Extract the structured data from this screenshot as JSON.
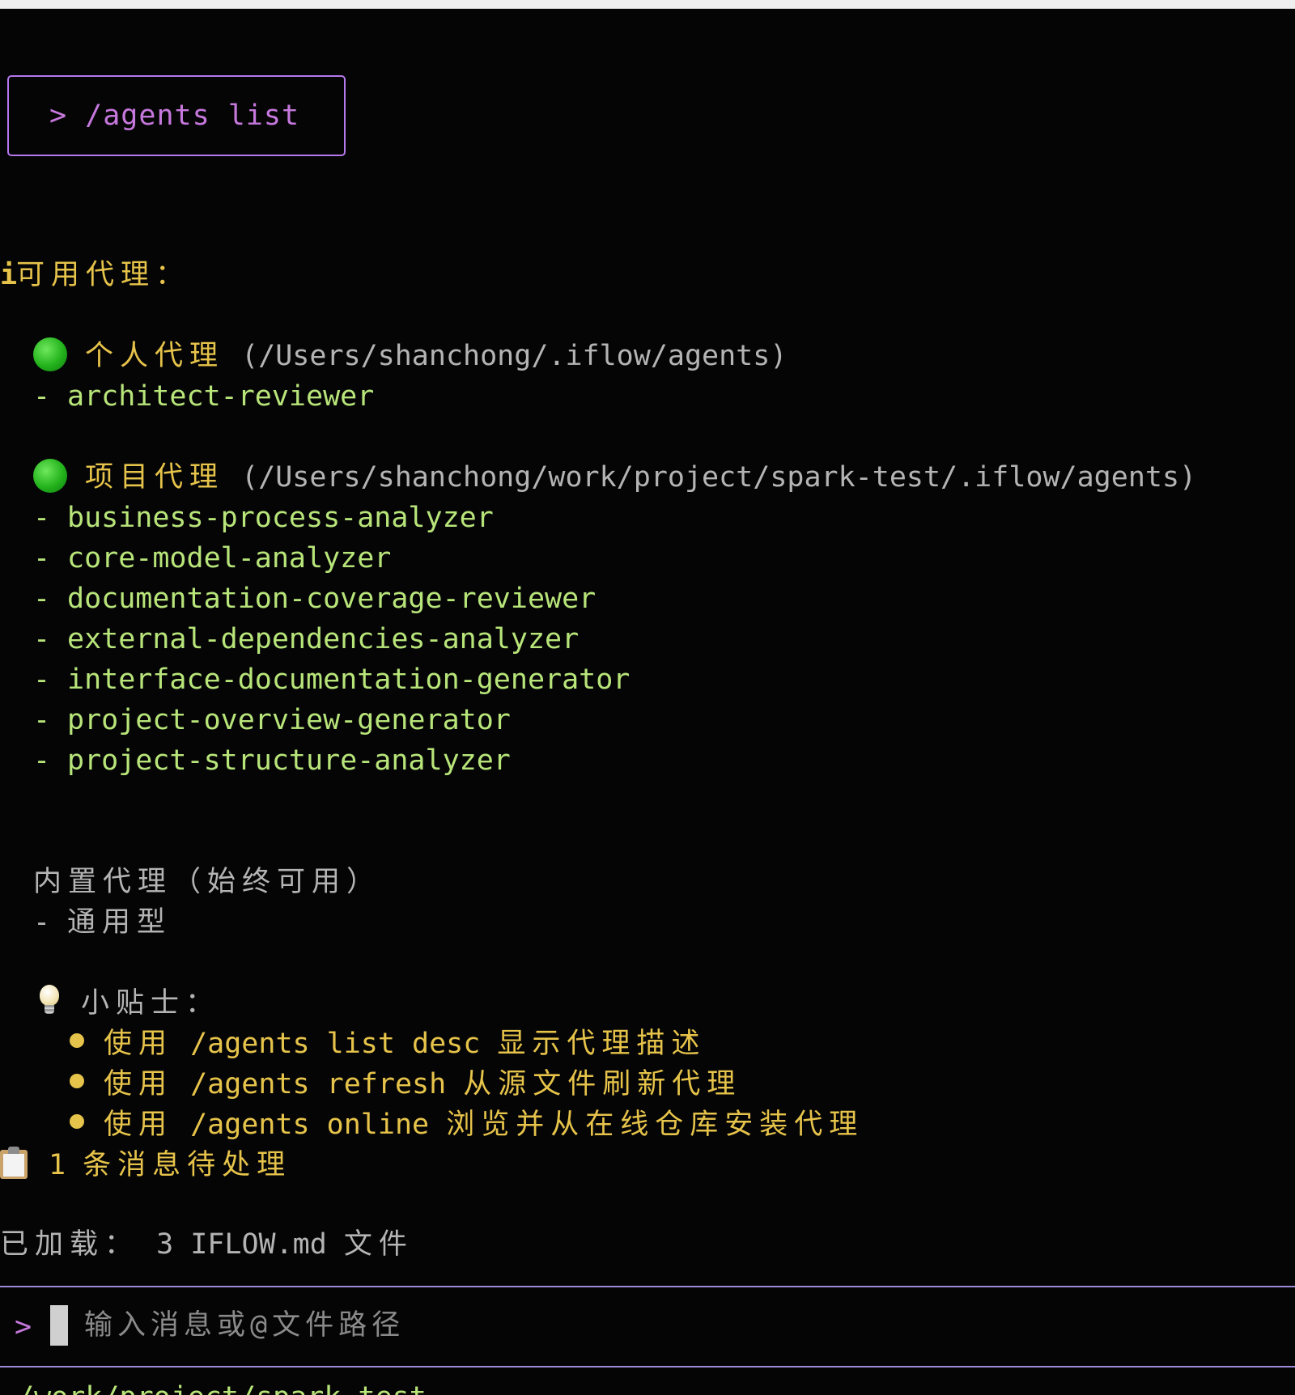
{
  "command": {
    "prompt": ">",
    "text": "/agents list"
  },
  "output": {
    "heading": "可用代理：",
    "personal": {
      "title": "个人代理",
      "path": "(/Users/shanchong/.iflow/agents)",
      "items": [
        "architect-reviewer"
      ]
    },
    "project": {
      "title": "项目代理",
      "path": "(/Users/shanchong/work/project/spark-test/.iflow/agents)",
      "items": [
        "business-process-analyzer",
        "core-model-analyzer",
        "documentation-coverage-reviewer",
        "external-dependencies-analyzer",
        "interface-documentation-generator",
        "project-overview-generator",
        "project-structure-analyzer"
      ]
    },
    "builtin": {
      "title": "内置代理（始终可用）",
      "items": [
        "通用型"
      ]
    },
    "tips": {
      "title": "小贴士：",
      "items": [
        {
          "prefix": "使用",
          "cmd": "/agents list desc",
          "desc": "显示代理描述"
        },
        {
          "prefix": "使用",
          "cmd": "/agents refresh",
          "desc": "从源文件刷新代理"
        },
        {
          "prefix": "使用",
          "cmd": "/agents online",
          "desc": "浏览并从在线仓库安装代理"
        }
      ]
    },
    "pending": {
      "count": "1",
      "text": "条消息待处理"
    },
    "loaded": {
      "label": "已加载：",
      "value": "3 IFLOW.md",
      "unit": "文件"
    }
  },
  "input": {
    "prompt": ">",
    "placeholder": "输入消息或@文件路径"
  },
  "status_path": "~/work/project/spark-test",
  "colors": {
    "accent": "#c678dd",
    "yellow": "#e6c34a",
    "green": "#b8e57a",
    "border": "#b478ec"
  },
  "icons": [
    "info-icon",
    "green-circle-icon",
    "lightbulb-icon",
    "clipboard-icon",
    "cursor"
  ]
}
